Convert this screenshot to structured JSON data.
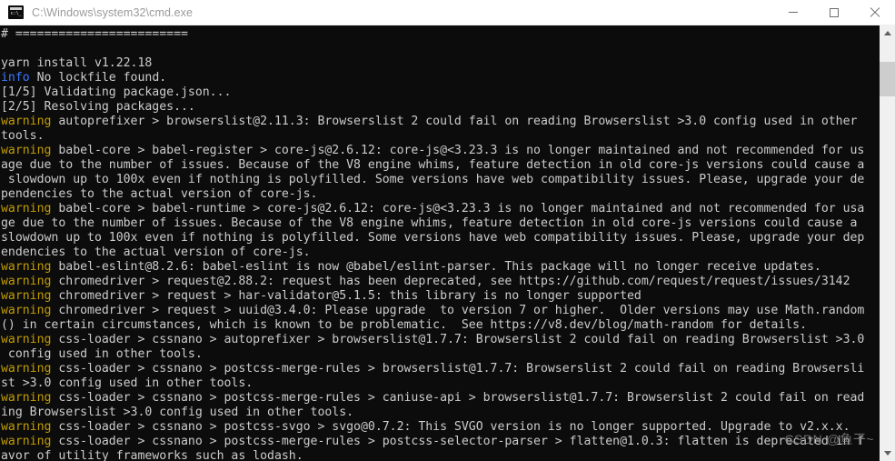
{
  "window": {
    "title": "C:\\Windows\\system32\\cmd.exe",
    "icon": "cmd-console-icon",
    "controls": {
      "minimize": "minimize-icon",
      "maximize": "maximize-icon",
      "close": "close-icon"
    },
    "colors": {
      "titlebar_bg": "#ffffff",
      "titlebar_text": "#9a9a9a",
      "console_bg": "#0c0c0c",
      "console_text": "#cccccc",
      "warning": "#c19c00",
      "info": "#3b78ff",
      "scrollbar_track": "#f0f0f0",
      "scrollbar_thumb": "#cdcdcd"
    }
  },
  "scrollbar": {
    "up_arrow": "scroll-up-arrow-icon",
    "down_arrow": "scroll-down-arrow-icon",
    "thumb": "scrollbar-thumb"
  },
  "watermark": {
    "text": "CSDN @鱼干~"
  },
  "console": {
    "lines": [
      [
        {
          "t": "# ========================",
          "c": "white"
        }
      ],
      [
        {
          "t": "",
          "c": "white"
        }
      ],
      [
        {
          "t": "yarn install v1.22.18",
          "c": "white"
        }
      ],
      [
        {
          "t": "info",
          "c": "info"
        },
        {
          "t": " No lockfile found.",
          "c": "white"
        }
      ],
      [
        {
          "t": "[1/5] Validating package.json...",
          "c": "white"
        }
      ],
      [
        {
          "t": "[2/5] Resolving packages...",
          "c": "white"
        }
      ],
      [
        {
          "t": "warning",
          "c": "warning"
        },
        {
          "t": " autoprefixer > browserslist@2.11.3: Browserslist 2 could fail on reading Browserslist >3.0 config used in other",
          "c": "white"
        }
      ],
      [
        {
          "t": "tools.",
          "c": "white"
        }
      ],
      [
        {
          "t": "warning",
          "c": "warning"
        },
        {
          "t": " babel-core > babel-register > core-js@2.6.12: core-js@<3.23.3 is no longer maintained and not recommended for us",
          "c": "white"
        }
      ],
      [
        {
          "t": "age due to the number of issues. Because of the V8 engine whims, feature detection in old core-js versions could cause a",
          "c": "white"
        }
      ],
      [
        {
          "t": " slowdown up to 100x even if nothing is polyfilled. Some versions have web compatibility issues. Please, upgrade your de",
          "c": "white"
        }
      ],
      [
        {
          "t": "pendencies to the actual version of core-js.",
          "c": "white"
        }
      ],
      [
        {
          "t": "warning",
          "c": "warning"
        },
        {
          "t": " babel-core > babel-runtime > core-js@2.6.12: core-js@<3.23.3 is no longer maintained and not recommended for usa",
          "c": "white"
        }
      ],
      [
        {
          "t": "ge due to the number of issues. Because of the V8 engine whims, feature detection in old core-js versions could cause a",
          "c": "white"
        }
      ],
      [
        {
          "t": "slowdown up to 100x even if nothing is polyfilled. Some versions have web compatibility issues. Please, upgrade your dep",
          "c": "white"
        }
      ],
      [
        {
          "t": "endencies to the actual version of core-js.",
          "c": "white"
        }
      ],
      [
        {
          "t": "warning",
          "c": "warning"
        },
        {
          "t": " babel-eslint@8.2.6: babel-eslint is now @babel/eslint-parser. This package will no longer receive updates.",
          "c": "white"
        }
      ],
      [
        {
          "t": "warning",
          "c": "warning"
        },
        {
          "t": " chromedriver > request@2.88.2: request has been deprecated, see https://github.com/request/request/issues/3142",
          "c": "white"
        }
      ],
      [
        {
          "t": "warning",
          "c": "warning"
        },
        {
          "t": " chromedriver > request > har-validator@5.1.5: this library is no longer supported",
          "c": "white"
        }
      ],
      [
        {
          "t": "warning",
          "c": "warning"
        },
        {
          "t": " chromedriver > request > uuid@3.4.0: Please upgrade  to version 7 or higher.  Older versions may use Math.random",
          "c": "white"
        }
      ],
      [
        {
          "t": "() in certain circumstances, which is known to be problematic.  See https://v8.dev/blog/math-random for details.",
          "c": "white"
        }
      ],
      [
        {
          "t": "warning",
          "c": "warning"
        },
        {
          "t": " css-loader > cssnano > autoprefixer > browserslist@1.7.7: Browserslist 2 could fail on reading Browserslist >3.0",
          "c": "white"
        }
      ],
      [
        {
          "t": " config used in other tools.",
          "c": "white"
        }
      ],
      [
        {
          "t": "warning",
          "c": "warning"
        },
        {
          "t": " css-loader > cssnano > postcss-merge-rules > browserslist@1.7.7: Browserslist 2 could fail on reading Browsersli",
          "c": "white"
        }
      ],
      [
        {
          "t": "st >3.0 config used in other tools.",
          "c": "white"
        }
      ],
      [
        {
          "t": "warning",
          "c": "warning"
        },
        {
          "t": " css-loader > cssnano > postcss-merge-rules > caniuse-api > browserslist@1.7.7: Browserslist 2 could fail on read",
          "c": "white"
        }
      ],
      [
        {
          "t": "ing Browserslist >3.0 config used in other tools.",
          "c": "white"
        }
      ],
      [
        {
          "t": "warning",
          "c": "warning"
        },
        {
          "t": " css-loader > cssnano > postcss-svgo > svgo@0.7.2: This SVGO version is no longer supported. Upgrade to v2.x.x.",
          "c": "white"
        }
      ],
      [
        {
          "t": "warning",
          "c": "warning"
        },
        {
          "t": " css-loader > cssnano > postcss-merge-rules > postcss-selector-parser > flatten@1.0.3: flatten is deprecated in f",
          "c": "white"
        }
      ],
      [
        {
          "t": "avor of utility frameworks such as lodash.",
          "c": "white"
        }
      ]
    ]
  }
}
